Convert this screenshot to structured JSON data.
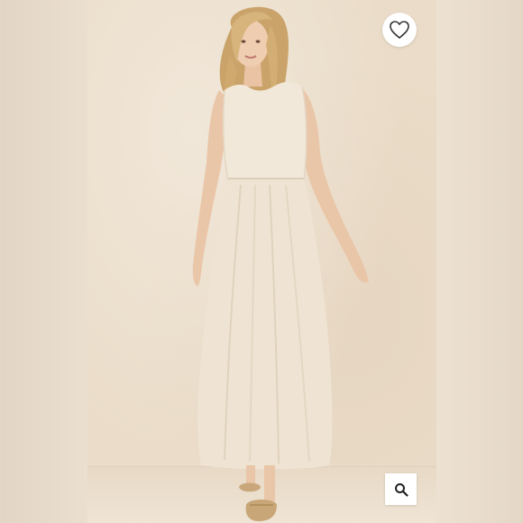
{
  "listing": {
    "image_alt": "",
    "accent": "#e9dccb"
  },
  "actions": {
    "like_icon": "heart-outline-icon",
    "zoom_icon": "magnifier-icon"
  }
}
